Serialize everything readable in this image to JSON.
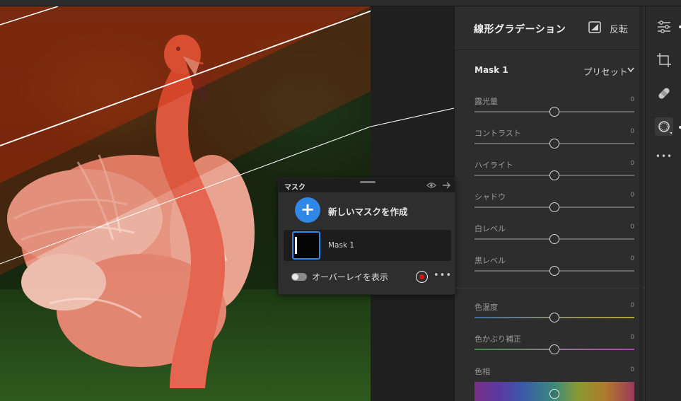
{
  "panel": {
    "title": "線形グラデーション",
    "invert_label": "反転",
    "mask_name": "Mask 1",
    "preset_label": "プリセット"
  },
  "sliders": [
    {
      "label": "露光量",
      "value": "0",
      "position": 0.5
    },
    {
      "label": "コントラスト",
      "value": "0",
      "position": 0.5
    },
    {
      "label": "ハイライト",
      "value": "0",
      "position": 0.5
    },
    {
      "label": "シャドウ",
      "value": "0",
      "position": 0.5
    },
    {
      "label": "白レベル",
      "value": "0",
      "position": 0.5
    },
    {
      "label": "黒レベル",
      "value": "0",
      "position": 0.5
    },
    {
      "label": "色温度",
      "value": "0",
      "position": 0.5
    },
    {
      "label": "色かぶり補正",
      "value": "0",
      "position": 0.5
    },
    {
      "label": "色相",
      "value": "0",
      "position": 0.5
    }
  ],
  "mask_panel": {
    "title": "マスク",
    "new_mask_label": "新しいマスクを作成",
    "mask_item_label": "Mask 1",
    "overlay_label": "オーバーレイを表示",
    "overlay_on": true,
    "overlay_color": "#e01010",
    "more": "•••"
  },
  "tools": {
    "more": "•••"
  },
  "colors": {
    "accent": "#2f87e8",
    "panel_bg": "#2d2d2d"
  }
}
